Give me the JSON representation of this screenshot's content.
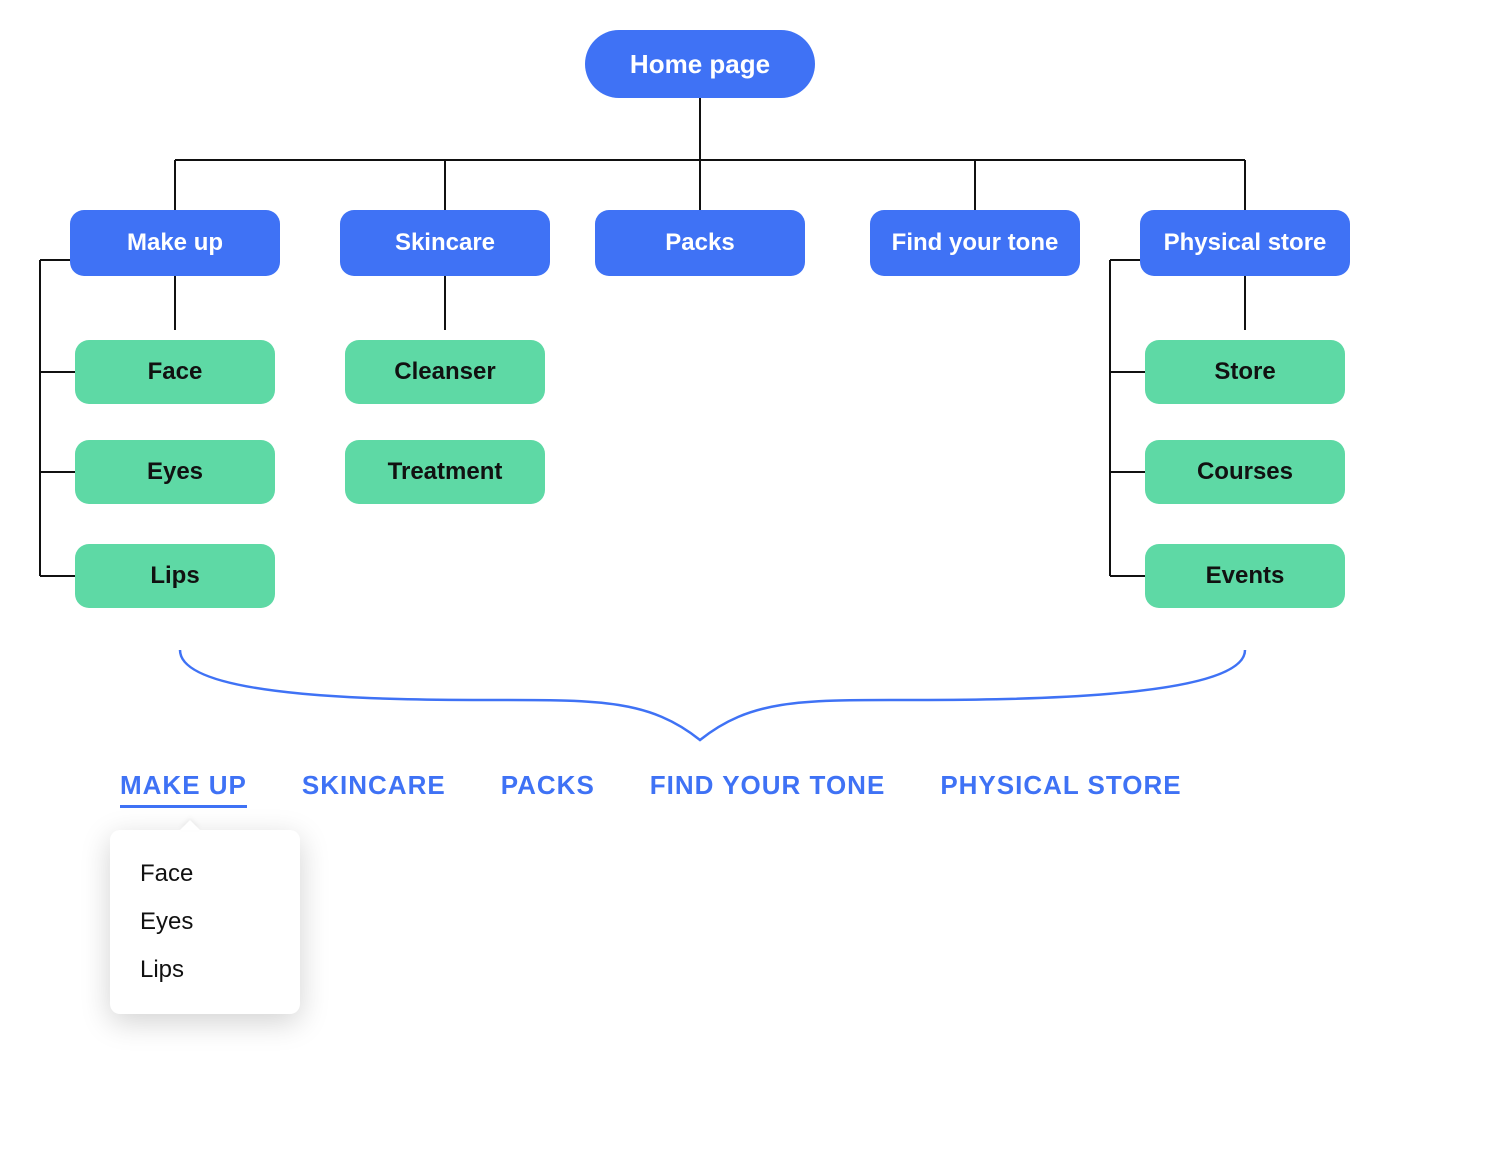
{
  "root": {
    "label": "Home page"
  },
  "categories": [
    {
      "label": "Make up",
      "children": [
        "Face",
        "Eyes",
        "Lips"
      ]
    },
    {
      "label": "Skincare",
      "children": [
        "Cleanser",
        "Treatment"
      ]
    },
    {
      "label": "Packs",
      "children": []
    },
    {
      "label": "Find your tone",
      "children": []
    },
    {
      "label": "Physical store",
      "children": [
        "Store",
        "Courses",
        "Events"
      ]
    }
  ],
  "menu": {
    "items": [
      "MAKE UP",
      "SKINCARE",
      "PACKS",
      "FIND YOUR TONE",
      "PHYSICAL STORE"
    ],
    "active_index": 0,
    "dropdown": [
      "Face",
      "Eyes",
      "Lips"
    ]
  },
  "colors": {
    "primary": "#3F72F5",
    "accent": "#5ED9A5",
    "text_dark": "#111111",
    "brace": "#3F72F5"
  }
}
